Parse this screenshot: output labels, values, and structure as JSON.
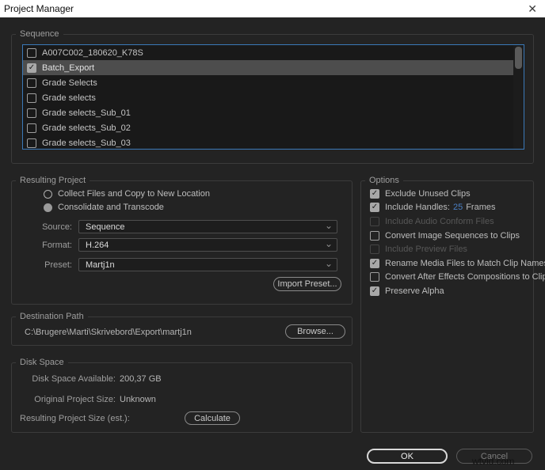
{
  "window": {
    "title": "Project Manager",
    "close_icon": "✕"
  },
  "icons": {
    "check": "✓",
    "chevron_down": "⌄"
  },
  "colors": {
    "titlebar_bg": "#ffffff",
    "dialog_bg": "#232323",
    "focus_border_blue": "#3b79b8",
    "hot_text_blue": "#4a7fc4",
    "selected_row_bg": "#4d4d4d"
  },
  "sequence": {
    "label": "Sequence",
    "items": [
      {
        "label": "A007C002_180620_K78S",
        "checked": false,
        "selected": false
      },
      {
        "label": "Batch_Export",
        "checked": true,
        "selected": true
      },
      {
        "label": "Grade Selects",
        "checked": false,
        "selected": false
      },
      {
        "label": "Grade selects",
        "checked": false,
        "selected": false
      },
      {
        "label": "Grade selects_Sub_01",
        "checked": false,
        "selected": false
      },
      {
        "label": "Grade selects_Sub_02",
        "checked": false,
        "selected": false
      },
      {
        "label": "Grade selects_Sub_03",
        "checked": false,
        "selected": false
      }
    ]
  },
  "resulting_project": {
    "label": "Resulting Project",
    "radio_collect": {
      "label": "Collect Files and Copy to New Location",
      "selected": false
    },
    "radio_consolidate": {
      "label": "Consolidate and Transcode",
      "selected": true
    },
    "source": {
      "label": "Source:",
      "value": "Sequence"
    },
    "format": {
      "label": "Format:",
      "value": "H.264"
    },
    "preset": {
      "label": "Preset:",
      "value": "Martj1n"
    },
    "import_preset_button": "Import Preset..."
  },
  "options": {
    "label": "Options",
    "items": [
      {
        "label": "Exclude Unused Clips",
        "checked": true,
        "disabled": false
      },
      {
        "label": "Include Handles:",
        "hot_value": "25",
        "suffix": "Frames",
        "checked": true,
        "disabled": false
      },
      {
        "label": "Include Audio Conform Files",
        "checked": false,
        "disabled": true
      },
      {
        "label": "Convert Image Sequences to Clips",
        "checked": false,
        "disabled": false
      },
      {
        "label": "Include Preview Files",
        "checked": false,
        "disabled": true
      },
      {
        "label": "Rename Media Files to Match Clip Names",
        "checked": true,
        "disabled": false
      },
      {
        "label": "Convert After Effects Compositions to Clips",
        "checked": false,
        "disabled": false
      },
      {
        "label": "Preserve Alpha",
        "checked": true,
        "disabled": false
      }
    ]
  },
  "destination_path": {
    "label": "Destination Path",
    "path": "C:\\Brugere\\Marti\\Skrivebord\\Export\\martj1n",
    "browse_button": "Browse..."
  },
  "disk_space": {
    "label": "Disk Space",
    "available": {
      "label": "Disk Space Available:",
      "value": "200,37 GB"
    },
    "original": {
      "label": "Original Project Size:",
      "value": "Unknown"
    },
    "resulting": {
      "label": "Resulting Project Size (est.):"
    },
    "calculate_button": "Calculate"
  },
  "footer": {
    "ok_button": "OK",
    "cancel_button": "Cancel",
    "watermark": "wtvid.com"
  }
}
